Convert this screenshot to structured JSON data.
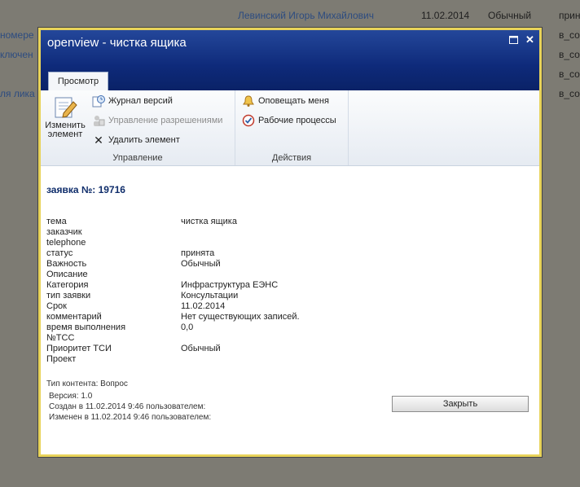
{
  "background": {
    "rows": [
      {
        "left": "",
        "name": "Левинский Игорь Михайлович",
        "date": "11.02.2014",
        "priority": "Обычный",
        "right": "прин"
      },
      {
        "left": "номере",
        "right": "в_со"
      },
      {
        "left": "ключен",
        "right": "в_со"
      },
      {
        "left": "",
        "right": "в_со"
      },
      {
        "left": "ля лика",
        "right": "в_со"
      }
    ]
  },
  "dialog": {
    "title": "openview - чистка ящика",
    "tab": "Просмотр",
    "ribbon": {
      "manage": {
        "label": "Управление",
        "edit": "Изменить элемент",
        "version_history": "Журнал версий",
        "permissions": "Управление разрешениями",
        "delete": "Удалить элемент"
      },
      "actions": {
        "label": "Действия",
        "alert": "Оповещать меня",
        "workflows": "Рабочие процессы"
      }
    },
    "item_title": "заявка №: 19716",
    "fields": [
      {
        "label": "тема",
        "value": "чистка ящика"
      },
      {
        "label": "заказчик",
        "value": ""
      },
      {
        "label": "telephone",
        "value": ""
      },
      {
        "label": "статус",
        "value": "принята"
      },
      {
        "label": "Важность",
        "value": "Обычный"
      },
      {
        "label": "Описание",
        "value": ""
      },
      {
        "label": "Категория",
        "value": "Инфраструктура ЕЭНС"
      },
      {
        "label": "тип заявки",
        "value": "Консультации"
      },
      {
        "label": "Срок",
        "value": "11.02.2014"
      },
      {
        "label": "комментарий",
        "value": "Нет существующих записей."
      },
      {
        "label": "время выполнения",
        "value": "0,0"
      },
      {
        "label": "№ТСС",
        "value": ""
      },
      {
        "label": "Приоритет ТСИ",
        "value": "Обычный"
      },
      {
        "label": "Проект",
        "value": ""
      }
    ],
    "content_type": "Тип контента: Вопрос",
    "version": "Версия: 1.0",
    "created": "Создан в 11.02.2014 9:46 пользователем:",
    "modified": "Изменен в 11.02.2014 9:46 пользователем:",
    "close_label": "Закрыть"
  }
}
